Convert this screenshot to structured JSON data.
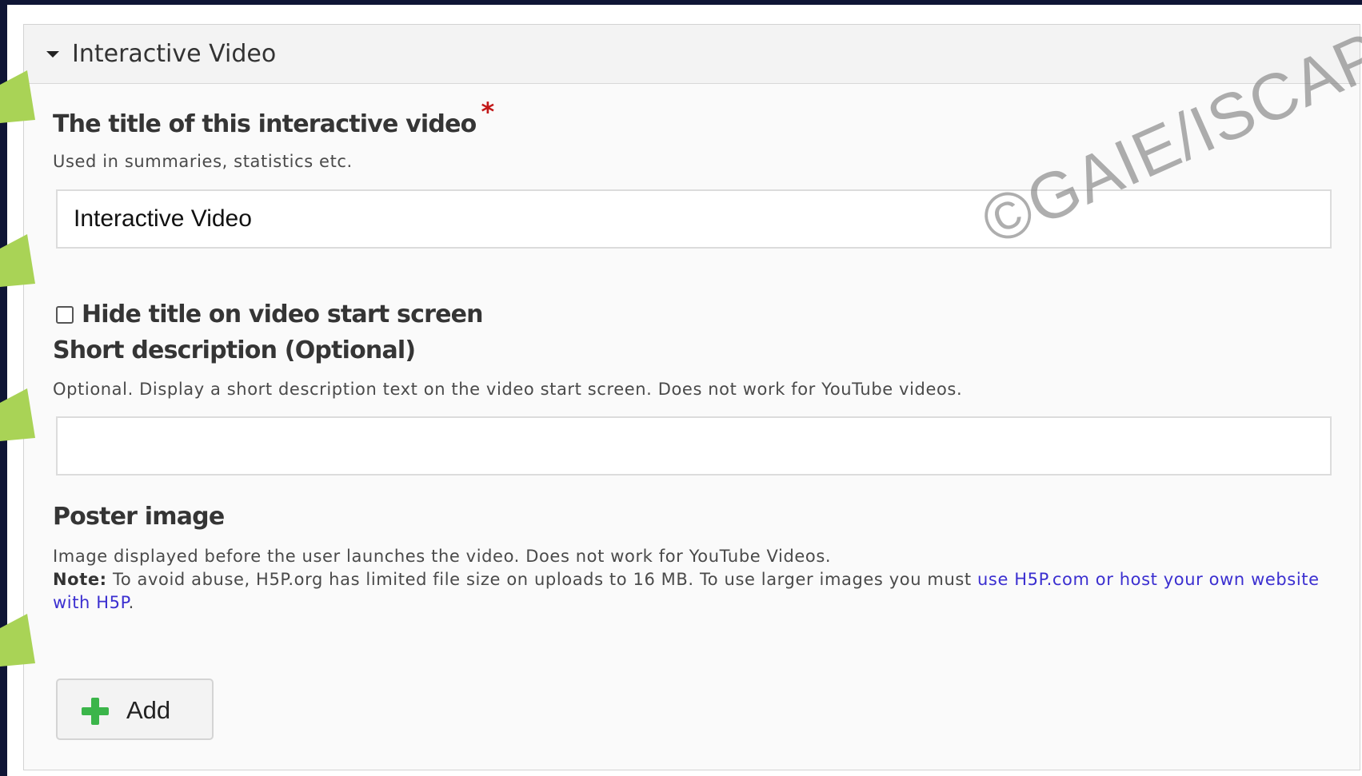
{
  "panel": {
    "title": "Interactive Video"
  },
  "title_field": {
    "label": "The title of this interactive video",
    "required_mark": "*",
    "description": "Used in summaries, statistics etc.",
    "value": "Interactive Video"
  },
  "hide_title": {
    "label": "Hide title on video start screen",
    "checked": false
  },
  "short_description": {
    "label": "Short description (Optional)",
    "description": "Optional. Display a short description text on the video start screen. Does not work for YouTube videos.",
    "value": ""
  },
  "poster_image": {
    "label": "Poster image",
    "description": "Image displayed before the user launches the video. Does not work for YouTube Videos.",
    "note_label": "Note:",
    "note_text": " To avoid abuse, H5P.org has limited file size on uploads to 16 MB. To use larger images you must ",
    "note_link": "use H5P.com or host your own website with H5P",
    "note_end": ".",
    "add_label": "Add"
  },
  "watermark": "©GAIE/ISCAP",
  "colors": {
    "background": "#0f1535",
    "required": "#c31919",
    "link": "#3b2fd0",
    "add_icon": "#3bb54a",
    "pointer_arrow": "#a9d356"
  },
  "icons": {
    "panel_toggle": "caret-down-icon",
    "add": "plus-icon",
    "annotation": "pointer-arrow-icon"
  }
}
